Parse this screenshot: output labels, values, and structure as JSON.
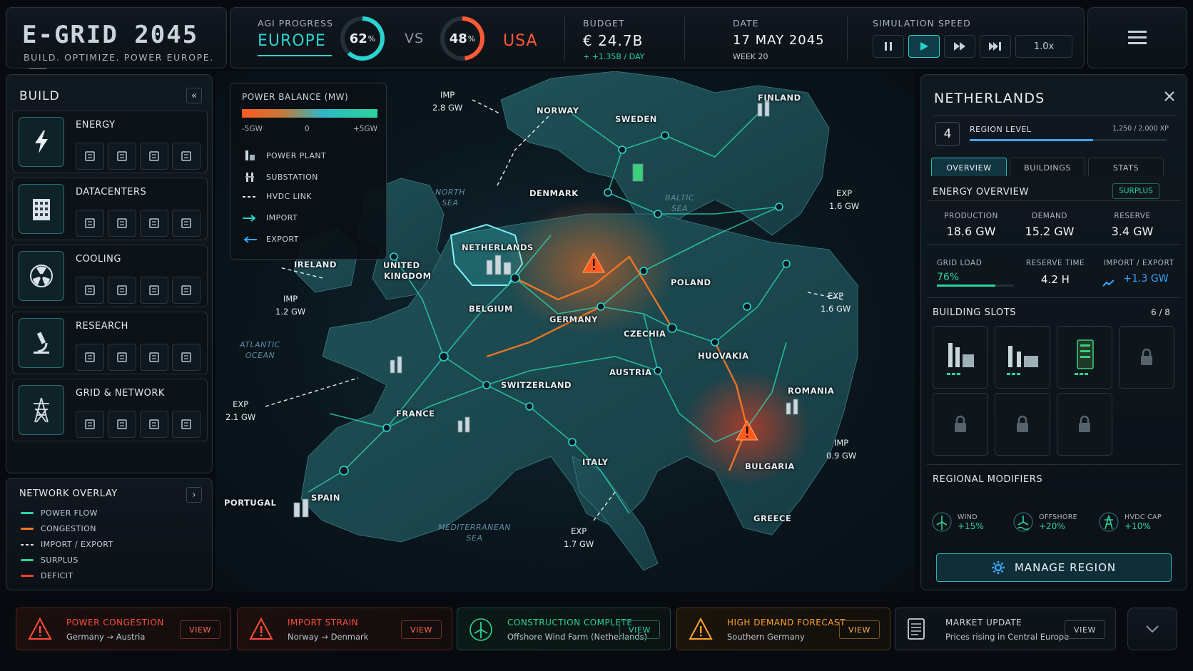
{
  "brand": {
    "title": "E-GRID 2045",
    "tagline": "BUILD. OPTIMIZE. POWER EUROPE."
  },
  "topbar": {
    "agi_label": "AGI PROGRESS",
    "player": {
      "name": "EUROPE",
      "progress_pct": 62,
      "progress_text": "62"
    },
    "vs": "VS",
    "rival": {
      "name": "USA",
      "progress_pct": 48,
      "progress_text": "48"
    },
    "pct_sign": "%",
    "budget_label": "BUDGET",
    "budget_value": "€ 24.7B",
    "budget_delta": "+ +1.35B / DAY",
    "date_label": "DATE",
    "date_value": "17 MAY 2045",
    "week": "WEEK 20",
    "speed_label": "SIMULATION SPEED",
    "speed_value": "1.0x"
  },
  "build": {
    "header": "BUILD",
    "categories": [
      {
        "name": "ENERGY",
        "icon": "lightning-icon",
        "subs": [
          "wind-turbine-icon",
          "solar-panel-icon",
          "power-plant-icon",
          "battery-icon"
        ]
      },
      {
        "name": "DATACENTERS",
        "icon": "datacenter-icon",
        "subs": [
          "server-rack-icon",
          "server-block-icon",
          "server-tower-icon",
          "server-cube-icon"
        ]
      },
      {
        "name": "COOLING",
        "icon": "fan-icon",
        "subs": [
          "cooling-tower-icon",
          "fan-icon",
          "snowflake-icon",
          "water-drop-icon"
        ]
      },
      {
        "name": "RESEARCH",
        "icon": "microscope-icon",
        "subs": [
          "chip-icon",
          "flask-icon",
          "gear-brain-icon",
          "graduation-cap-icon"
        ]
      },
      {
        "name": "GRID & NETWORK",
        "icon": "pylon-icon",
        "subs": [
          "transmission-tower-icon",
          "substation-icon",
          "satellite-dish-icon",
          "network-node-icon"
        ]
      }
    ]
  },
  "network_overlay": {
    "header": "NETWORK OVERLAY",
    "items": [
      {
        "label": "POWER FLOW",
        "color": "#2bd4b0",
        "style": "solid"
      },
      {
        "label": "CONGESTION",
        "color": "#ff7a22",
        "style": "solid"
      },
      {
        "label": "IMPORT / EXPORT",
        "color": "#e6eef3",
        "style": "dashed"
      },
      {
        "label": "SURPLUS",
        "color": "#2bd49a",
        "style": "solid"
      },
      {
        "label": "DEFICIT",
        "color": "#ff3b2b",
        "style": "solid"
      }
    ]
  },
  "power_balance": {
    "header": "POWER BALANCE (MW)",
    "ticks": [
      "-5GW",
      "0",
      "+5GW"
    ],
    "legend": [
      "POWER PLANT",
      "SUBSTATION",
      "HVDC LINK",
      "IMPORT",
      "EXPORT"
    ]
  },
  "map": {
    "countries": [
      "NORWAY",
      "SWEDEN",
      "FINLAND",
      "DENMARK",
      "IRELAND",
      "UNITED",
      "KINGDOM",
      "NETHERLANDS",
      "BELGIUM",
      "GERMANY",
      "POLAND",
      "CZECHIA",
      "HUOVAKIA",
      "AUSTRIA",
      "SWITZERLAND",
      "FRANCE",
      "ROMANIA",
      "BULGARIA",
      "ITALY",
      "PORTUGAL",
      "SPAIN",
      "GREECE"
    ],
    "seas": [
      [
        "NORTH",
        "SEA"
      ],
      [
        "BALTIC",
        "SEA"
      ],
      [
        "ATLANTIC",
        "OCEAN"
      ],
      [
        "MEDITERRANEAN",
        "SEA"
      ]
    ],
    "flows": [
      {
        "kind": "IMP",
        "value": "2.8 GW"
      },
      {
        "kind": "EXP",
        "value": "1.6 GW"
      },
      {
        "kind": "IMP",
        "value": "1.2 GW"
      },
      {
        "kind": "EXP",
        "value": "1.6 GW"
      },
      {
        "kind": "EXP",
        "value": "2.1 GW"
      },
      {
        "kind": "IMP",
        "value": "0.9 GW"
      },
      {
        "kind": "EXP",
        "value": "1.7 GW"
      }
    ]
  },
  "region": {
    "name": "NETHERLANDS",
    "level": "4",
    "level_label": "REGION LEVEL",
    "xp": "1,250 / 2,000 XP",
    "xp_fraction": 0.625,
    "tabs": [
      "OVERVIEW",
      "BUILDINGS",
      "STATS"
    ],
    "energy_header": "ENERGY OVERVIEW",
    "energy_badge": "SURPLUS",
    "production_label": "PRODUCTION",
    "production": "18.6 GW",
    "demand_label": "DEMAND",
    "demand": "15.2 GW",
    "reserve_label": "RESERVE",
    "reserve": "3.4 GW",
    "grid_load_label": "GRID LOAD",
    "grid_load": "76%",
    "grid_load_fraction": 0.76,
    "reserve_time_label": "RESERVE TIME",
    "reserve_time": "4.2 H",
    "import_export_label": "IMPORT / EXPORT",
    "import_export": "+1.3 GW",
    "slots_header": "BUILDING SLOTS",
    "slots_count": "6 / 8",
    "modifiers_header": "REGIONAL MODIFIERS",
    "modifiers": [
      {
        "label": "WIND",
        "value": "+15%"
      },
      {
        "label": "OFFSHORE",
        "value": "+20%"
      },
      {
        "label": "HVDC CAP",
        "value": "+10%"
      }
    ],
    "manage": "MANAGE REGION"
  },
  "alerts": [
    {
      "title": "POWER CONGESTION",
      "subtitle": "Germany → Austria",
      "action": "VIEW",
      "tone": "red"
    },
    {
      "title": "IMPORT STRAIN",
      "subtitle": "Norway → Denmark",
      "action": "VIEW",
      "tone": "red"
    },
    {
      "title": "CONSTRUCTION COMPLETE",
      "subtitle": "Offshore Wind Farm (Netherlands)",
      "action": "VIEW",
      "tone": "green"
    },
    {
      "title": "HIGH DEMAND FORECAST",
      "subtitle": "Southern Germany",
      "action": "VIEW",
      "tone": "orange"
    },
    {
      "title": "MARKET UPDATE",
      "subtitle": "Prices rising in Central Europe",
      "action": "VIEW",
      "tone": "gray"
    }
  ],
  "colors": {
    "accent": "#2bd4d0",
    "rival": "#ff5a36",
    "surplus": "#2bd49a",
    "congestion": "#ff7a22"
  }
}
